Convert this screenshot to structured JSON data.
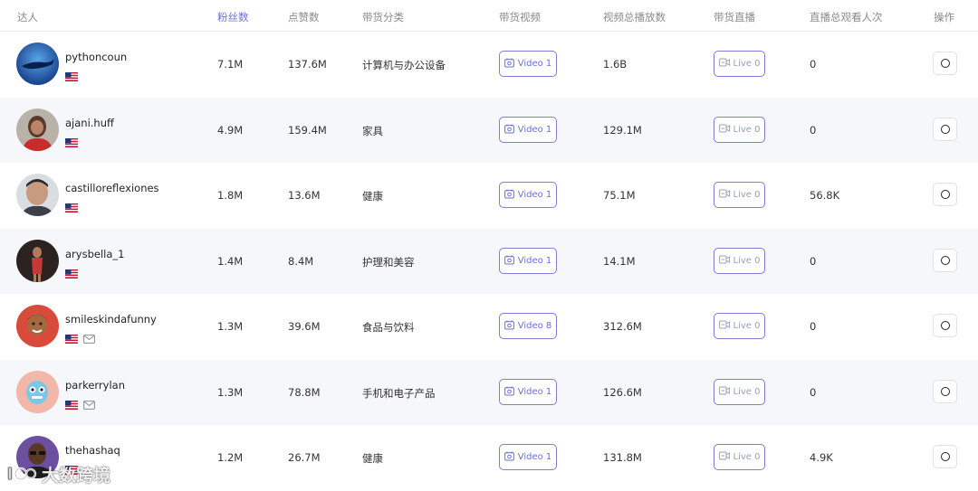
{
  "headers": {
    "talent": "达人",
    "followers": "粉丝数",
    "likes": "点赞数",
    "category": "带货分类",
    "videos": "带货视频",
    "video_views": "视频总播放数",
    "live": "带货直播",
    "live_viewers": "直播总观看人次",
    "actions": "操作"
  },
  "rows": [
    {
      "name": "pythoncoun",
      "followers": "7.1M",
      "likes": "137.6M",
      "category": "计算机与办公设备",
      "video_label": "Video 1",
      "views": "1.6B",
      "live_label": "Live 0",
      "live_viewers": "0",
      "has_mail": false
    },
    {
      "name": "ajani.huff",
      "followers": "4.9M",
      "likes": "159.4M",
      "category": "家具",
      "video_label": "Video 1",
      "views": "129.1M",
      "live_label": "Live 0",
      "live_viewers": "0",
      "has_mail": false
    },
    {
      "name": "castilloreflexiones",
      "followers": "1.8M",
      "likes": "13.6M",
      "category": "健康",
      "video_label": "Video 1",
      "views": "75.1M",
      "live_label": "Live 0",
      "live_viewers": "56.8K",
      "has_mail": false
    },
    {
      "name": "arysbella_1",
      "followers": "1.4M",
      "likes": "8.4M",
      "category": "护理和美容",
      "video_label": "Video 1",
      "views": "14.1M",
      "live_label": "Live 0",
      "live_viewers": "0",
      "has_mail": false
    },
    {
      "name": "smileskindafunny",
      "followers": "1.3M",
      "likes": "39.6M",
      "category": "食品与饮料",
      "video_label": "Video 8",
      "views": "312.6M",
      "live_label": "Live 0",
      "live_viewers": "0",
      "has_mail": true
    },
    {
      "name": "parkerrylan",
      "followers": "1.3M",
      "likes": "78.8M",
      "category": "手机和电子产品",
      "video_label": "Video 1",
      "views": "126.6M",
      "live_label": "Live 0",
      "live_viewers": "0",
      "has_mail": true
    },
    {
      "name": "thehashaq",
      "followers": "1.2M",
      "likes": "26.7M",
      "category": "健康",
      "video_label": "Video 1",
      "views": "131.8M",
      "live_label": "Live 0",
      "live_viewers": "4.9K",
      "has_mail": false
    }
  ],
  "watermark": "大数跨境",
  "colors": {
    "accent": "#6d6fd6",
    "row_alt": "#f6f7fb"
  },
  "icons": {
    "flag": "us-flag-icon",
    "mail": "mail-icon",
    "video": "video-icon",
    "live": "live-camera-icon",
    "action": "circle-icon"
  }
}
